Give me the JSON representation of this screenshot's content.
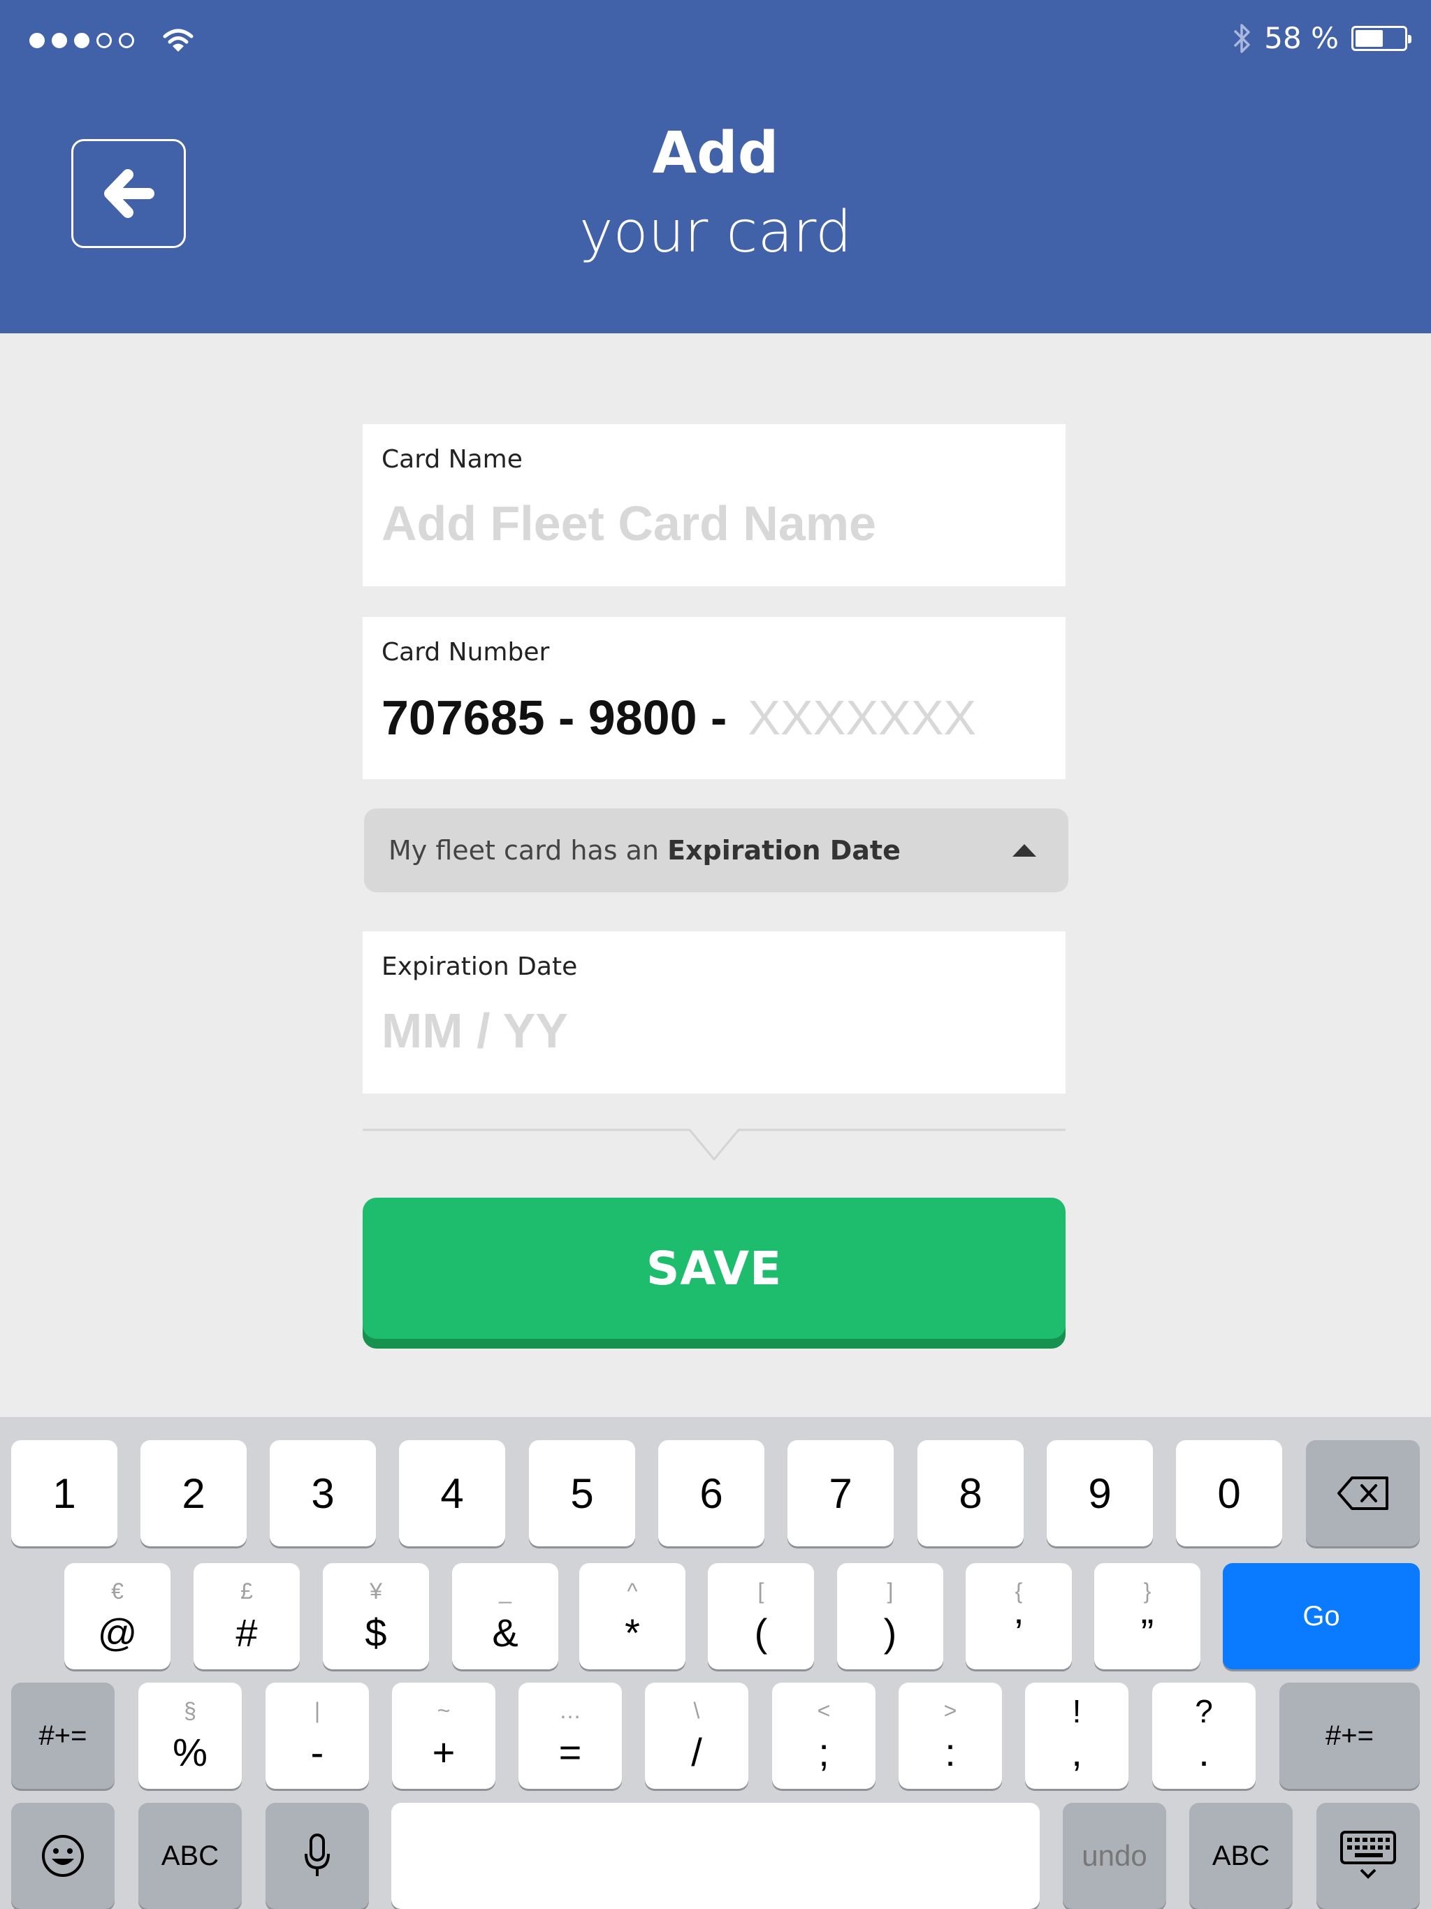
{
  "status": {
    "signal_dots": [
      true,
      true,
      true,
      false,
      false
    ],
    "battery_text": "58 %",
    "battery_level": 0.58
  },
  "header": {
    "title": "Add",
    "subtitle": "your card"
  },
  "form": {
    "card_name_label": "Card Name",
    "card_name_placeholder": "Add Fleet Card Name",
    "card_number_label": "Card Number",
    "card_number_prefix": "707685 - 9800 -",
    "card_number_placeholder": "XXXXXXX",
    "expiration_toggle_prefix": "My fleet card has an ",
    "expiration_toggle_bold": "Expiration Date",
    "expiration_label": "Expiration Date",
    "expiration_placeholder": "MM / YY",
    "save_label": "SAVE"
  },
  "keyboard": {
    "row1": [
      "1",
      "2",
      "3",
      "4",
      "5",
      "6",
      "7",
      "8",
      "9",
      "0"
    ],
    "row2": [
      {
        "top": "€",
        "main": "@"
      },
      {
        "top": "£",
        "main": "#"
      },
      {
        "top": "¥",
        "main": "$"
      },
      {
        "top": "_",
        "main": "&"
      },
      {
        "top": "^",
        "main": "*"
      },
      {
        "top": "[",
        "main": "("
      },
      {
        "top": "]",
        "main": ")"
      },
      {
        "top": "{",
        "main": "’"
      },
      {
        "top": "}",
        "main": "”"
      }
    ],
    "go_label": "Go",
    "row3": [
      {
        "top": "§",
        "main": "%"
      },
      {
        "top": "|",
        "main": "-"
      },
      {
        "top": "~",
        "main": "+"
      },
      {
        "top": "…",
        "main": "="
      },
      {
        "top": "\\",
        "main": "/"
      },
      {
        "top": "<",
        "main": ";"
      },
      {
        "top": ">",
        "main": ":"
      },
      {
        "top": "!",
        "main": ","
      },
      {
        "top": "?",
        "main": "."
      }
    ],
    "shift_label": "#+=",
    "abc_label": "ABC",
    "undo_label": "undo"
  }
}
